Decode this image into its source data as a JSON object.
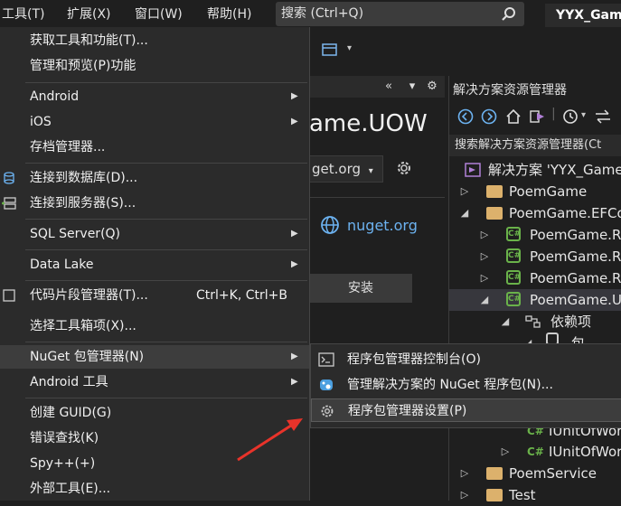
{
  "menubar": {
    "items": [
      "工具(T)",
      "扩展(X)",
      "窗口(W)",
      "帮助(H)"
    ],
    "search_label": "搜索 (Ctrl+Q)",
    "app_title": "YYX_Gam"
  },
  "middle": {
    "doc_title": "ame.UOW",
    "source_select": "get.org",
    "nuget_link": "nuget.org",
    "install_label": "安装",
    "toolbar_buttons": [
      "«",
      "▾",
      "⚙"
    ]
  },
  "solution_explorer": {
    "title": "解决方案资源管理器",
    "search_placeholder": "搜索解决方案资源管理器(Ct",
    "tree": [
      {
        "label": "解决方案 'YYX_Game",
        "type": "solution"
      },
      {
        "label": "PoemGame",
        "type": "folder",
        "arrow": "▷"
      },
      {
        "label": "PoemGame.EFCo",
        "type": "folder",
        "arrow": "◢"
      },
      {
        "label": "PoemGame.Re",
        "type": "cs",
        "arrow": "▷"
      },
      {
        "label": "PoemGame.Re",
        "type": "cs",
        "arrow": "▷"
      },
      {
        "label": "PoemGame.Re",
        "type": "cs",
        "arrow": "▷"
      },
      {
        "label": "PoemGame.U",
        "type": "cs",
        "arrow": "◢"
      },
      {
        "label": "依赖项",
        "type": "deps",
        "arrow": "◢"
      },
      {
        "label": "包",
        "type": "pkg",
        "arrow": "◢"
      },
      {
        "label": "IUnitOfWor",
        "type": "csfile"
      },
      {
        "label": "IUnitOfWor",
        "type": "csfile"
      },
      {
        "label": "PoemService",
        "type": "folder",
        "arrow": "▷"
      },
      {
        "label": "Test",
        "type": "folder",
        "arrow": "▷"
      }
    ]
  },
  "tools_menu": {
    "items": [
      {
        "label": "获取工具和功能(T)..."
      },
      {
        "label": "管理和预览(P)功能"
      },
      {
        "label": "Android",
        "submenu": true
      },
      {
        "label": "iOS",
        "submenu": true
      },
      {
        "label": "存档管理器..."
      },
      {
        "label": "连接到数据库(D)...",
        "icon": "database-connect-icon"
      },
      {
        "label": "连接到服务器(S)...",
        "icon": "server-connect-icon"
      },
      {
        "label": "SQL Server(Q)",
        "submenu": true
      },
      {
        "label": "Data Lake",
        "submenu": true
      },
      {
        "label": "代码片段管理器(T)...",
        "shortcut": "Ctrl+K, Ctrl+B",
        "icon": "snippet-icon"
      },
      {
        "label": "选择工具箱项(X)..."
      },
      {
        "label": "NuGet 包管理器(N)",
        "submenu": true,
        "highlighted": true
      },
      {
        "label": "Android 工具",
        "submenu": true
      },
      {
        "label": "创建 GUID(G)"
      },
      {
        "label": "错误查找(K)"
      },
      {
        "label": "Spy++(+)"
      },
      {
        "label": "外部工具(E)..."
      }
    ]
  },
  "nuget_submenu": {
    "items": [
      {
        "label": "程序包管理器控制台(O)",
        "icon": "console-icon"
      },
      {
        "label": "管理解决方案的 NuGet 程序包(N)...",
        "icon": "nuget-icon"
      },
      {
        "label": "程序包管理器设置(P)",
        "icon": "gear-icon",
        "highlighted": true
      }
    ]
  },
  "colors": {
    "accent_link": "#6cb2f0",
    "annotation_arrow": "#e8332a",
    "menu_bg": "#2b2b2b"
  }
}
